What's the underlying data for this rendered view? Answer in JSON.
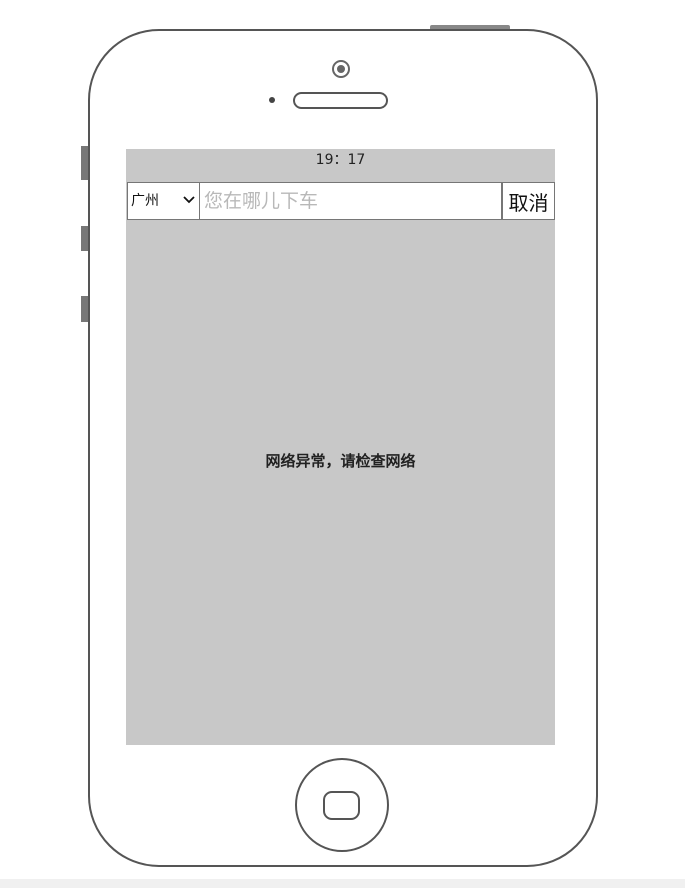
{
  "status_bar": {
    "time": "19：17"
  },
  "search_bar": {
    "city_selected": "广州",
    "input_value": "",
    "input_placeholder": "您在哪儿下车",
    "cancel_label": "取消"
  },
  "content": {
    "error_message": "网络异常，请检查网络"
  },
  "colors": {
    "screen_background": "#c8c8c8",
    "phone_outline": "#555555"
  },
  "icons": {
    "select_arrow": "chevron-down-icon",
    "home_button": "home-button-icon",
    "camera": "camera-icon",
    "speaker": "speaker-icon"
  }
}
